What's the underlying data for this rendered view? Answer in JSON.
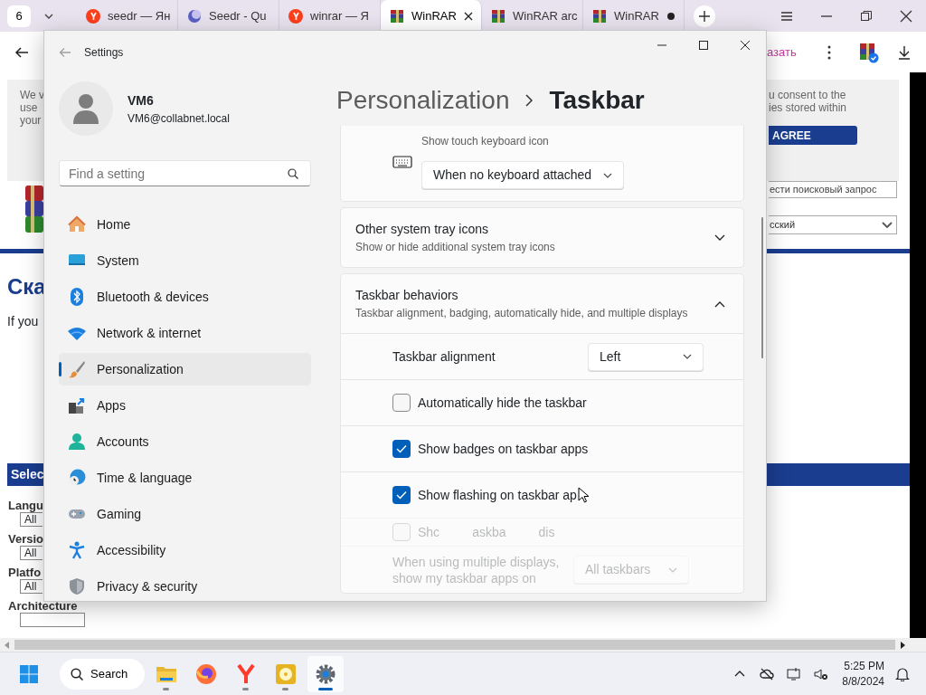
{
  "browser": {
    "tab_count": "6",
    "tabs": [
      {
        "title": "seedr — Ян",
        "selected": false,
        "has_dot": false
      },
      {
        "title": "Seedr - Qu",
        "selected": false,
        "has_dot": false
      },
      {
        "title": "winrar — Я",
        "selected": false,
        "has_dot": false
      },
      {
        "title": "WinRAR",
        "selected": true,
        "has_dot": false
      },
      {
        "title": "WinRAR arc",
        "selected": false,
        "has_dot": false
      },
      {
        "title": "WinRAR",
        "selected": false,
        "has_dot": true
      }
    ],
    "address_fragment": "азать"
  },
  "web_page": {
    "cookie_text_left": [
      "We v",
      "use",
      "your"
    ],
    "cookie_text_right": [
      "u consent to the",
      "ies stored within"
    ],
    "agree_button": "AGREE",
    "search_placeholder": "ести поисковый запрос",
    "language_select": "сский",
    "heading": "Ска",
    "intro": "If you",
    "filter_header": "Selec",
    "filters": [
      {
        "label": "Langu",
        "value": "All"
      },
      {
        "label": "Versio",
        "value": "All"
      },
      {
        "label": "Platfo",
        "value": "All"
      },
      {
        "label": "Architecture"
      }
    ]
  },
  "settings": {
    "window": {
      "title": "Settings"
    },
    "user": {
      "name": "VM6",
      "email": "VM6@collabnet.local"
    },
    "search": {
      "placeholder": "Find a setting"
    },
    "nav": [
      {
        "label": "Home",
        "selected": false
      },
      {
        "label": "System",
        "selected": false
      },
      {
        "label": "Bluetooth & devices",
        "selected": false
      },
      {
        "label": "Network & internet",
        "selected": false
      },
      {
        "label": "Personalization",
        "selected": true
      },
      {
        "label": "Apps",
        "selected": false
      },
      {
        "label": "Accounts",
        "selected": false
      },
      {
        "label": "Time & language",
        "selected": false
      },
      {
        "label": "Gaming",
        "selected": false
      },
      {
        "label": "Accessibility",
        "selected": false
      },
      {
        "label": "Privacy & security",
        "selected": false
      }
    ],
    "breadcrumb": [
      "Personalization",
      "Taskbar"
    ],
    "cards": [
      {
        "kind": "keyboard",
        "subtitle": "Show touch keyboard icon",
        "value": "When no keyboard attached"
      },
      {
        "kind": "expander",
        "title": "Other system tray icons",
        "subtitle": "Show or hide additional system tray icons",
        "expanded": false
      },
      {
        "kind": "expander",
        "title": "Taskbar behaviors",
        "subtitle": "Taskbar alignment, badging, automatically hide, and multiple displays",
        "expanded": true,
        "rows": [
          {
            "kind": "dropdown",
            "label": "Taskbar alignment",
            "value": "Left",
            "disabled": false
          },
          {
            "kind": "checkbox",
            "label": "Automatically hide the taskbar",
            "checked": false,
            "disabled": false
          },
          {
            "kind": "checkbox",
            "label": "Show badges on taskbar apps",
            "checked": true,
            "disabled": false
          },
          {
            "kind": "checkbox",
            "label": "Show flashing on taskbar ap",
            "checked": true,
            "disabled": false
          },
          {
            "kind": "fragments",
            "fragments": [
              "Shc",
              "askba",
              "dis"
            ],
            "checked": false,
            "disabled": true
          },
          {
            "kind": "dropdown",
            "label": "When using multiple displays, show my taskbar apps on",
            "value": "All taskbars",
            "disabled": true
          }
        ]
      }
    ]
  },
  "taskbar": {
    "search_label": "Search",
    "apps": [
      {
        "running": true,
        "selected": false
      },
      {
        "running": false,
        "selected": false
      },
      {
        "running": true,
        "selected": false
      },
      {
        "running": true,
        "selected": false
      },
      {
        "running": true,
        "selected": true
      }
    ],
    "time": "5:25 PM",
    "date": "8/8/2024"
  }
}
